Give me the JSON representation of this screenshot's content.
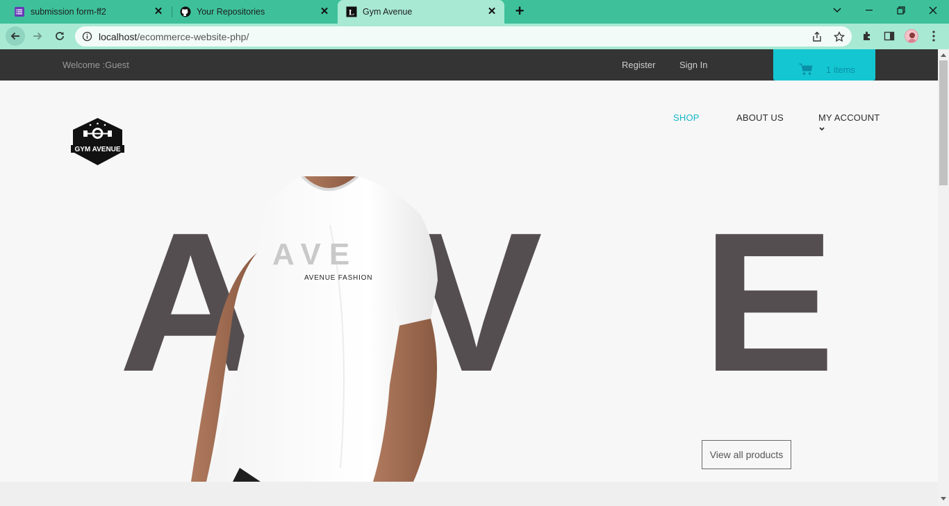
{
  "browser": {
    "tabs": [
      {
        "title": "submission form-ff2",
        "icon": "google-forms-icon"
      },
      {
        "title": "Your Repositories",
        "icon": "github-icon"
      },
      {
        "title": "Gym Avenue",
        "icon": "site-L-icon"
      }
    ],
    "active_tab": 2,
    "url_host": "localhost",
    "url_path": "/ecommerce-website-php/",
    "colors": {
      "frame": "#3ec19b",
      "toolbar": "#a8e9d4"
    }
  },
  "site": {
    "topbar": {
      "welcome": "Welcome :Guest",
      "register": "Register",
      "sign_in": "Sign In",
      "cart_count": "1 items"
    },
    "logo_text": "GYM AVENUE",
    "nav": {
      "shop": "SHOP",
      "about": "ABOUT US",
      "account": "MY ACCOUNT"
    },
    "hero": {
      "letters": [
        "A",
        "V",
        "E"
      ],
      "shirt_print": "AVE",
      "shirt_brand": "AVENUE FASHION"
    },
    "cta": "View all products",
    "colors": {
      "accent": "#14c6d2",
      "topbar": "#343434",
      "hero_letters": "#554e50"
    }
  }
}
